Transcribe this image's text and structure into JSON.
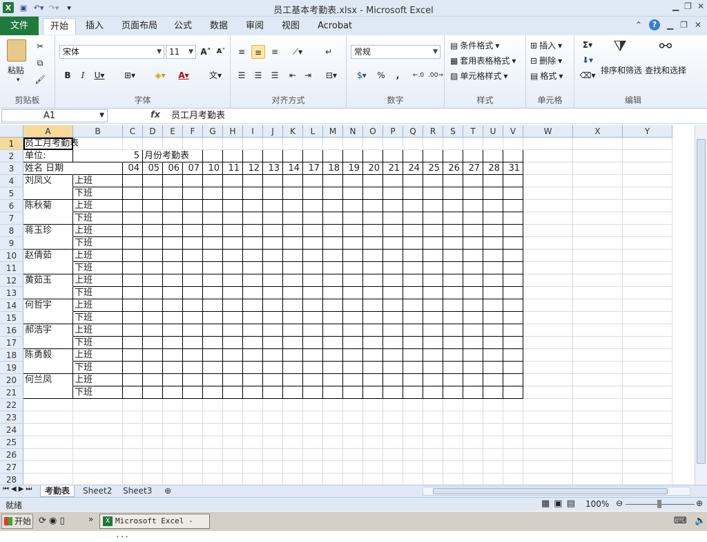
{
  "window": {
    "title": "员工基本考勤表.xlsx - Microsoft Excel"
  },
  "tabs": [
    "文件",
    "开始",
    "插入",
    "页面布局",
    "公式",
    "数据",
    "审阅",
    "视图",
    "Acrobat"
  ],
  "ribbon": {
    "clipboard": {
      "paste": "粘贴",
      "label": "剪贴板"
    },
    "font": {
      "name": "宋体",
      "size": "11",
      "label": "字体"
    },
    "align": {
      "label": "对齐方式"
    },
    "number": {
      "format": "常规",
      "percent": "%",
      "comma": ",",
      "inc": "+.0\n.00",
      "dec": ".00\n+.0",
      "label": "数字"
    },
    "styles": {
      "cond": "条件格式",
      "table": "套用表格格式",
      "cell": "单元格样式",
      "label": "样式"
    },
    "cells": {
      "insert": "插入",
      "delete": "删除",
      "format": "格式",
      "label": "单元格"
    },
    "edit": {
      "sigma": "Σ",
      "sort": "排序和筛选",
      "find": "查找和选择",
      "label": "编辑"
    }
  },
  "formula_bar": {
    "name_box": "A1",
    "fx": "fx",
    "value": "员工月考勤表"
  },
  "columns": [
    "A",
    "B",
    "C",
    "D",
    "E",
    "F",
    "G",
    "H",
    "I",
    "J",
    "K",
    "L",
    "M",
    "N",
    "O",
    "P",
    "Q",
    "R",
    "S",
    "T",
    "U",
    "V",
    "W",
    "X",
    "Y"
  ],
  "rows": [
    "1",
    "2",
    "3",
    "4",
    "5",
    "6",
    "7",
    "8",
    "9",
    "10",
    "11",
    "12",
    "13",
    "14",
    "15",
    "16",
    "17",
    "18",
    "19",
    "20",
    "21",
    "22",
    "23",
    "24",
    "25",
    "26",
    "27",
    "28"
  ],
  "sheet": {
    "a1": "员工月考勤表",
    "a2": "单位:",
    "c2": "5",
    "d2": "月份考勤表",
    "a3": "姓名   日期",
    "dates": [
      "04",
      "05",
      "06",
      "07",
      "10",
      "11",
      "12",
      "13",
      "14",
      "17",
      "18",
      "19",
      "20",
      "21",
      "24",
      "25",
      "26",
      "27",
      "28",
      "31"
    ],
    "shift_on": "上班",
    "shift_off": "下班",
    "employees": [
      "刘凤义",
      "陈秋菊",
      "蒋玉珍",
      "赵倩茹",
      "黄茹玉",
      "何哲宇",
      "郝浩宇",
      "陈勇毅",
      "何兰凤"
    ]
  },
  "sheet_tabs": [
    "考勤表",
    "Sheet2",
    "Sheet3"
  ],
  "status": {
    "ready": "就绪",
    "zoom": "100%"
  },
  "taskbar": {
    "start": "开始",
    "app": "Microsoft Excel - ..."
  }
}
